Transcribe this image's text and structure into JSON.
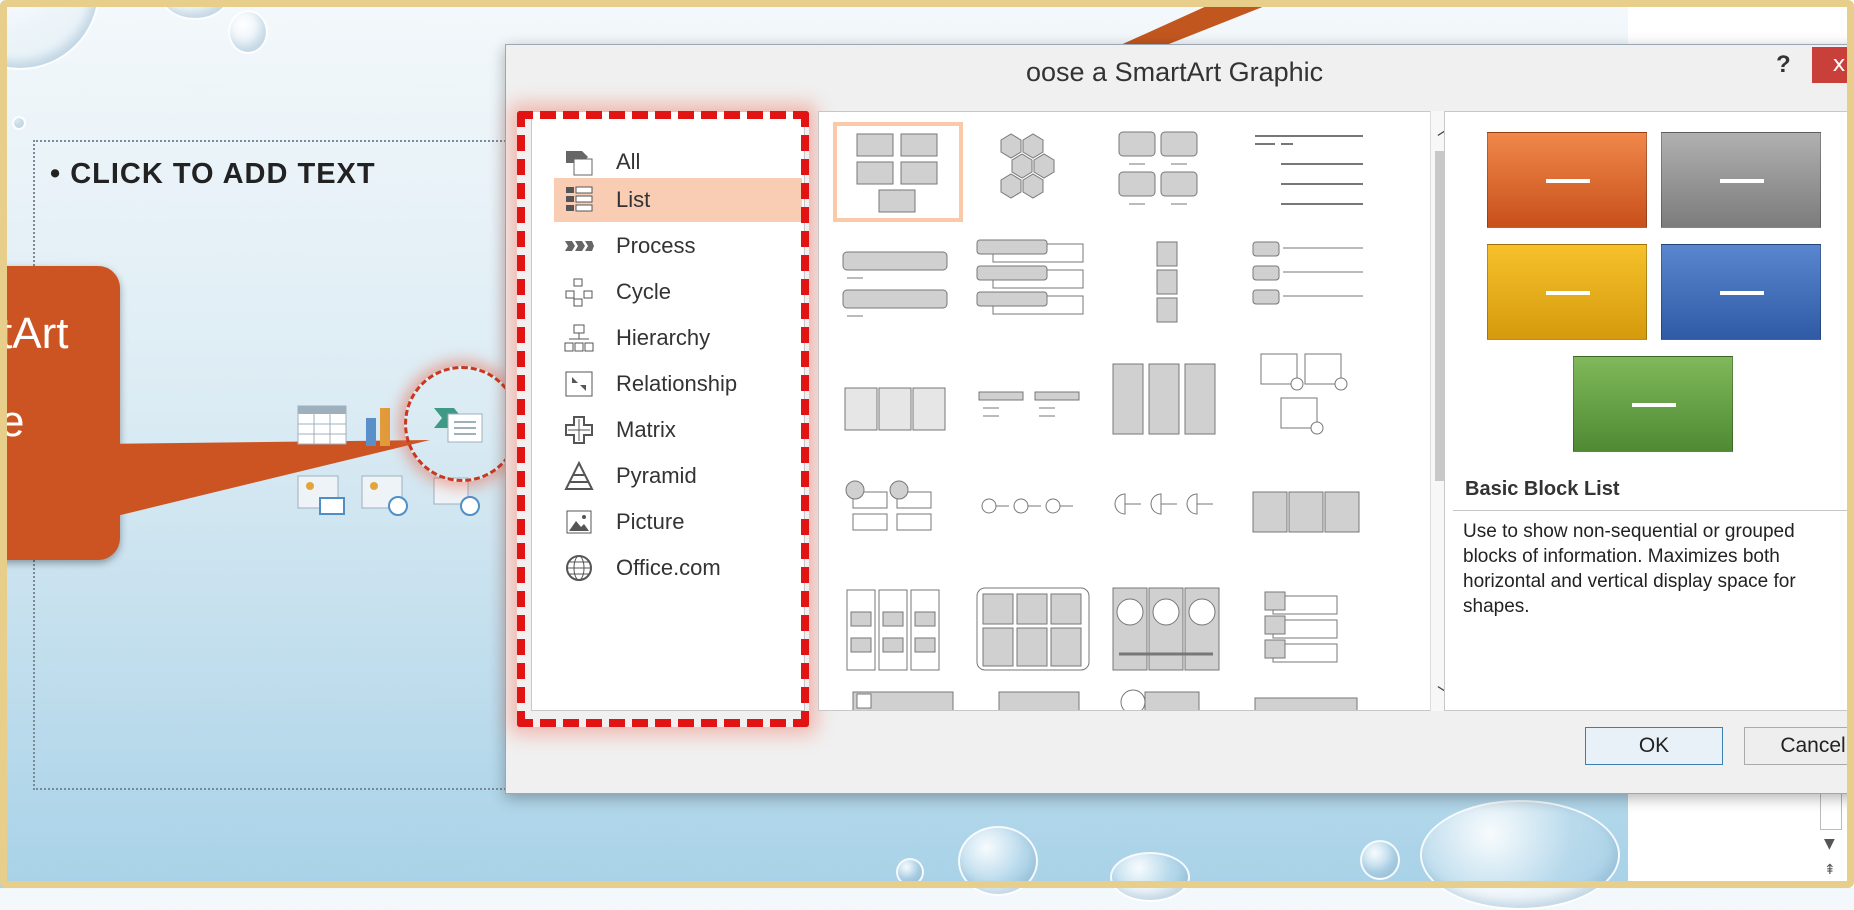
{
  "slide": {
    "bullet_text": "• CLICK TO ADD TEXT",
    "callout_text_line1": "tArt",
    "callout_text_line2": "e"
  },
  "dialog": {
    "title": "oose a SmartArt Graphic",
    "help_label": "?",
    "close_label": "x",
    "categories": [
      {
        "label": "All",
        "icon": "all-icon"
      },
      {
        "label": "List",
        "icon": "list-icon",
        "selected": true
      },
      {
        "label": "Process",
        "icon": "process-icon"
      },
      {
        "label": "Cycle",
        "icon": "cycle-icon"
      },
      {
        "label": "Hierarchy",
        "icon": "hierarchy-icon"
      },
      {
        "label": "Relationship",
        "icon": "relationship-icon"
      },
      {
        "label": "Matrix",
        "icon": "matrix-icon"
      },
      {
        "label": "Pyramid",
        "icon": "pyramid-icon"
      },
      {
        "label": "Picture",
        "icon": "picture-icon"
      },
      {
        "label": "Office.com",
        "icon": "globe-icon"
      }
    ],
    "preview": {
      "title": "Basic Block List",
      "description": "Use to show non-sequential or grouped blocks of information. Maximizes both horizontal and vertical display space for shapes.",
      "colors": [
        "#d9581f",
        "#8c8c8c",
        "#e4a617",
        "#3c67b6",
        "#5f9a3f"
      ]
    },
    "ok_label": "OK",
    "cancel_label": "Cancel"
  },
  "accent_color": "#cc5422",
  "highlight_color": "#e21313"
}
